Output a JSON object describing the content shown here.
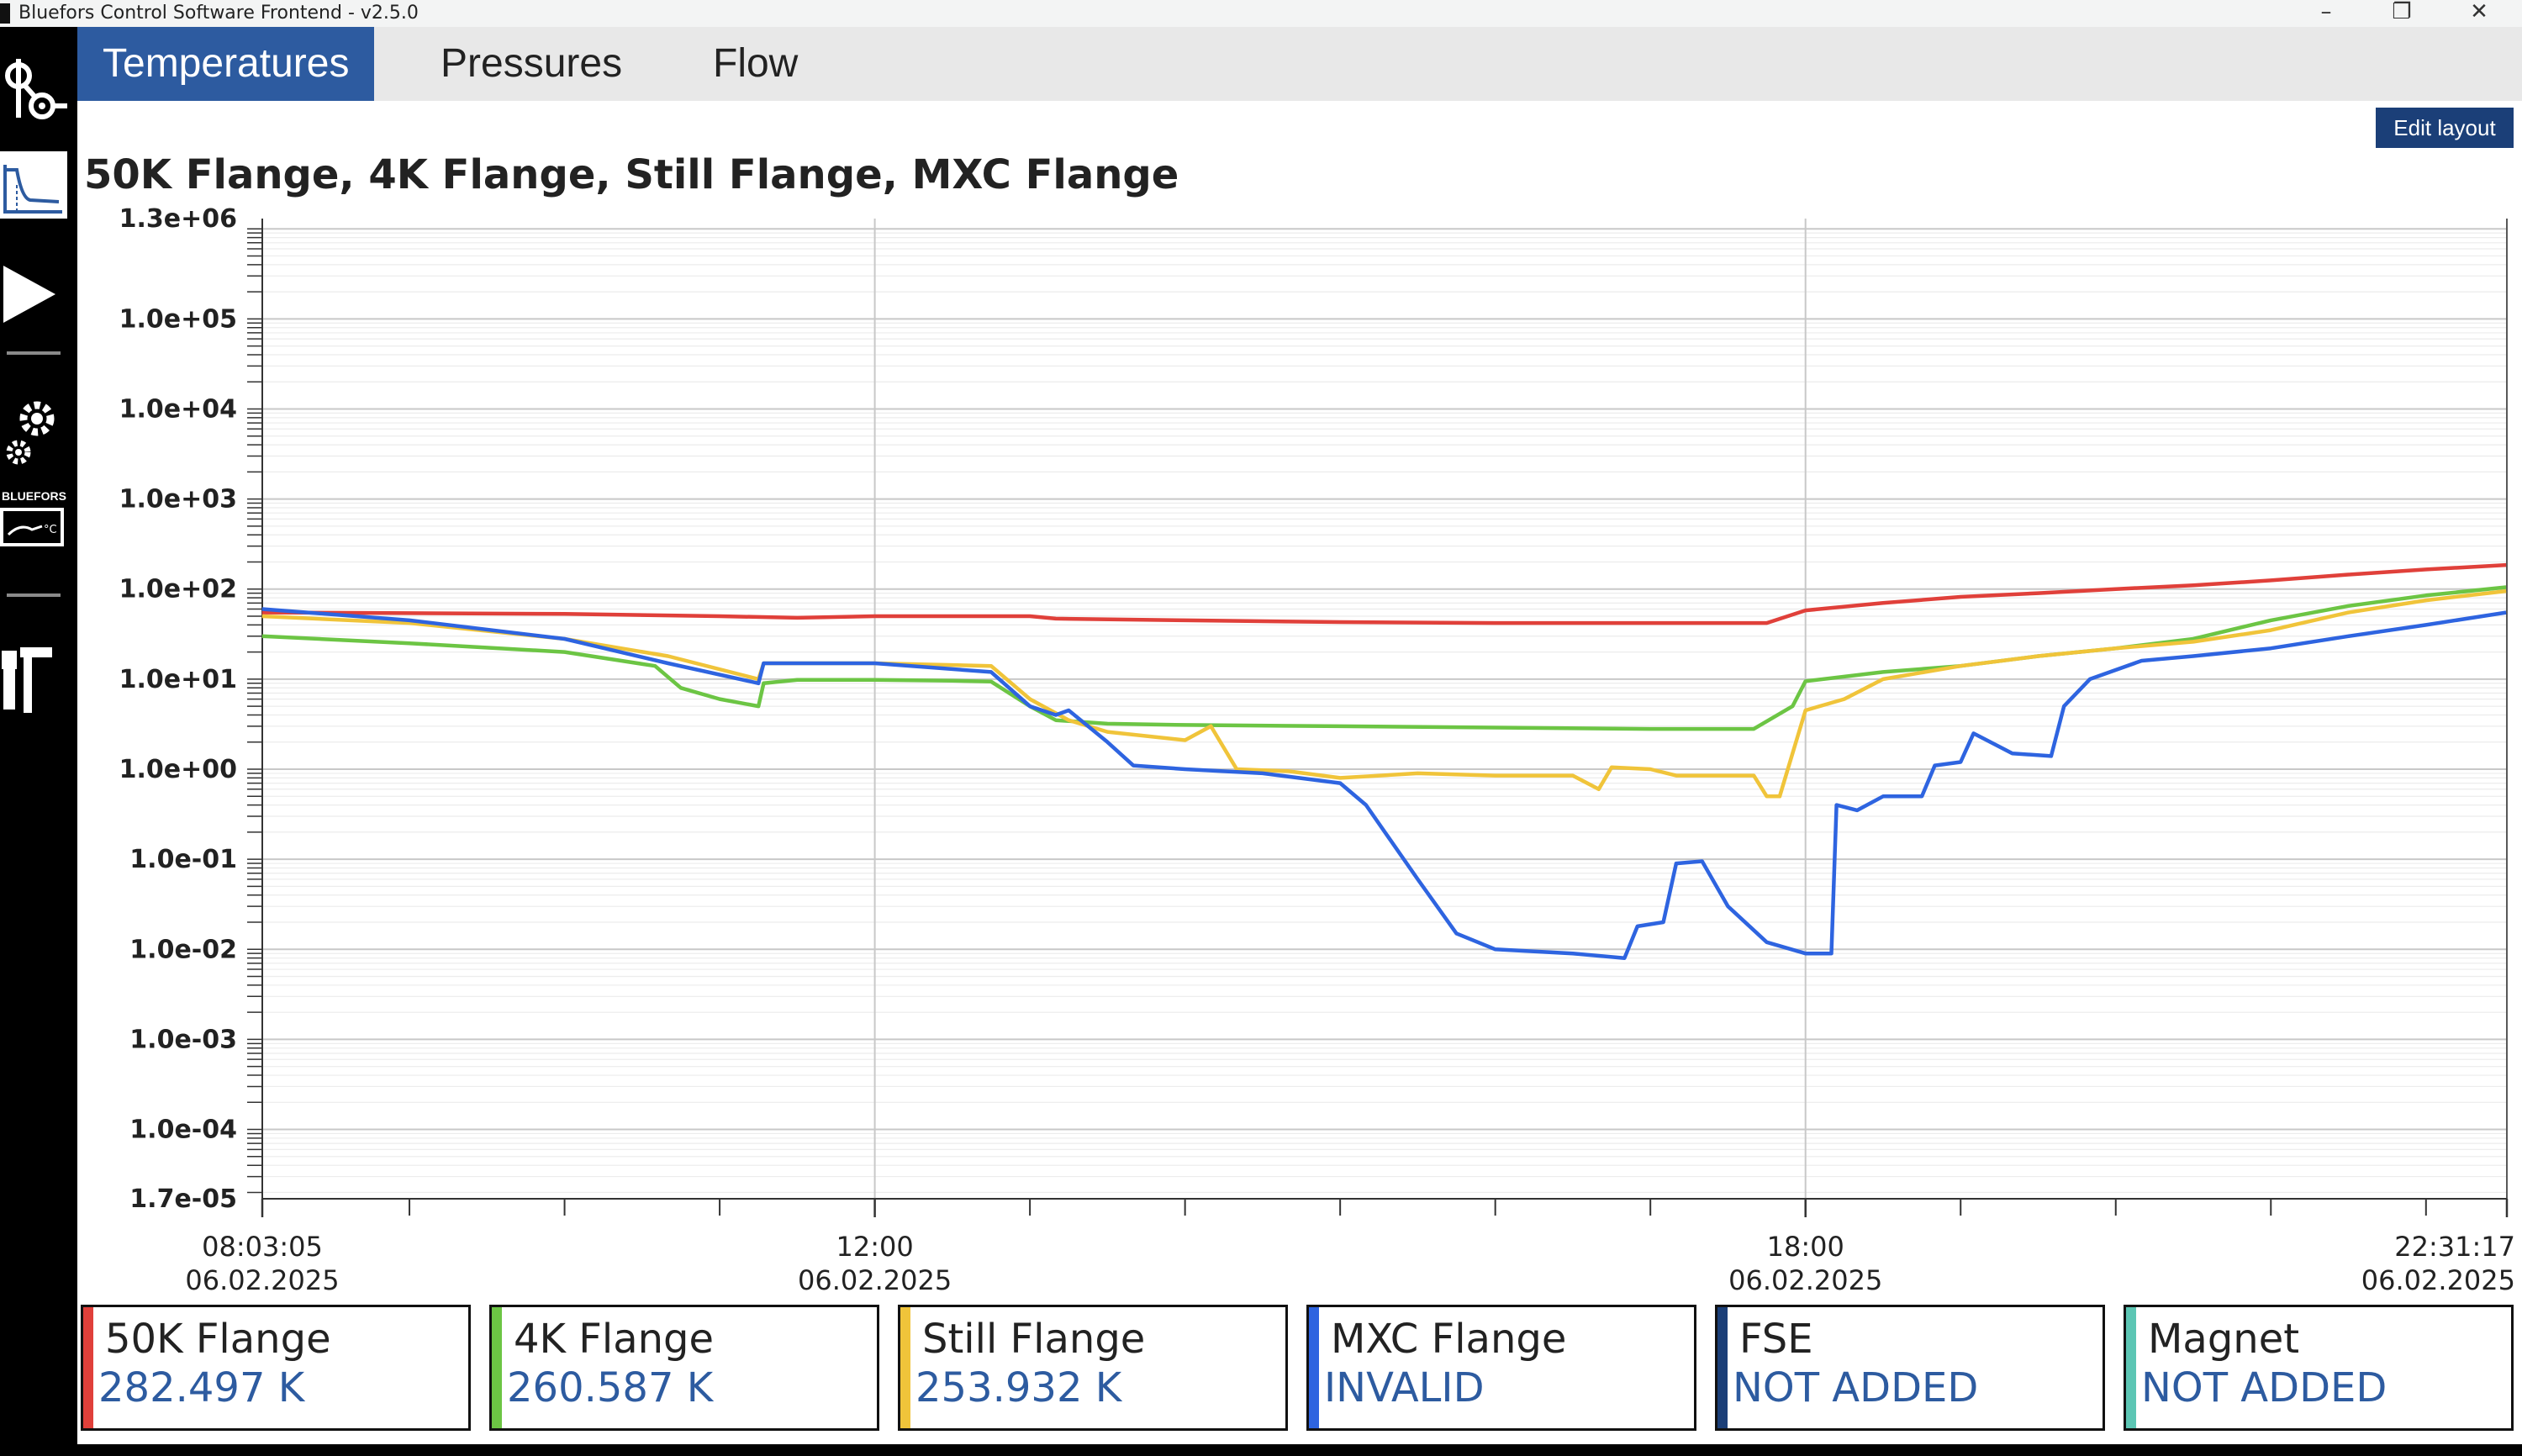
{
  "window": {
    "title": "Bluefors Control Software Frontend - v2.5.0",
    "controls": {
      "minimize": "–",
      "restore": "❐",
      "close": "✕"
    }
  },
  "sidebar": {
    "items": [
      {
        "icon": "gas-handling-icon"
      },
      {
        "icon": "play-icon"
      },
      {
        "icon": "gear-icon"
      },
      {
        "icon": "bluefors-temperature-icon",
        "label": "BLUEFORS"
      },
      {
        "icon": "tools-icon"
      }
    ]
  },
  "tabs": [
    {
      "label": "Temperatures",
      "active": true
    },
    {
      "label": "Pressures",
      "active": false
    },
    {
      "label": "Flow",
      "active": false
    }
  ],
  "toolbar": {
    "edit_layout_label": "Edit layout"
  },
  "chart": {
    "title": "50K Flange, 4K Flange, Still Flange, MXC Flange"
  },
  "chart_data": {
    "type": "line",
    "title": "50K Flange, 4K Flange, Still Flange, MXC Flange",
    "xlabel": "",
    "ylabel": "",
    "yscale": "log",
    "xlim": [
      "2025-02-06 08:03:05",
      "2025-02-06 22:31:17"
    ],
    "ylim": [
      1.7e-05,
      1300000.0
    ],
    "y_ticks": [
      {
        "value": 1300000.0,
        "label": "1.3e+06"
      },
      {
        "value": 100000.0,
        "label": "1.0e+05"
      },
      {
        "value": 10000.0,
        "label": "1.0e+04"
      },
      {
        "value": 1000.0,
        "label": "1.0e+03"
      },
      {
        "value": 100.0,
        "label": "1.0e+02"
      },
      {
        "value": 10.0,
        "label": "1.0e+01"
      },
      {
        "value": 1.0,
        "label": "1.0e+00"
      },
      {
        "value": 0.1,
        "label": "1.0e-01"
      },
      {
        "value": 0.01,
        "label": "1.0e-02"
      },
      {
        "value": 0.001,
        "label": "1.0e-03"
      },
      {
        "value": 0.0001,
        "label": "1.0e-04"
      },
      {
        "value": 1.7e-05,
        "label": "1.7e-05"
      }
    ],
    "x_ticks": [
      {
        "time": "2025-02-06 08:03:05",
        "label": "08:03:05",
        "date": "06.02.2025"
      },
      {
        "time": "2025-02-06 12:00:00",
        "label": "12:00",
        "date": "06.02.2025"
      },
      {
        "time": "2025-02-06 18:00:00",
        "label": "18:00",
        "date": "06.02.2025"
      },
      {
        "time": "2025-02-06 22:31:17",
        "label": "22:31:17",
        "date": "06.02.2025"
      }
    ],
    "x_minor_ticks": [
      "09:00",
      "10:00",
      "11:00",
      "13:00",
      "14:00",
      "15:00",
      "16:00",
      "17:00",
      "19:00",
      "20:00",
      "21:00",
      "22:00"
    ],
    "grid": true,
    "series": [
      {
        "name": "50K Flange",
        "color": "#e0403a",
        "points": [
          [
            "08:03",
            55
          ],
          [
            "09:00",
            54
          ],
          [
            "10:00",
            53
          ],
          [
            "11:00",
            50
          ],
          [
            "11:30",
            48
          ],
          [
            "12:00",
            50
          ],
          [
            "13:00",
            50
          ],
          [
            "13:10",
            47
          ],
          [
            "14:00",
            45
          ],
          [
            "15:00",
            43
          ],
          [
            "16:00",
            42
          ],
          [
            "17:00",
            42
          ],
          [
            "17:45",
            42
          ],
          [
            "18:00",
            58
          ],
          [
            "18:30",
            70
          ],
          [
            "19:00",
            82
          ],
          [
            "19:30",
            90
          ],
          [
            "20:00",
            100
          ],
          [
            "20:30",
            110
          ],
          [
            "21:00",
            125
          ],
          [
            "21:30",
            145
          ],
          [
            "22:00",
            165
          ],
          [
            "22:31",
            185
          ]
        ]
      },
      {
        "name": "4K Flange",
        "color": "#6cc544",
        "points": [
          [
            "08:03",
            30
          ],
          [
            "09:00",
            25
          ],
          [
            "10:00",
            20
          ],
          [
            "10:35",
            14
          ],
          [
            "10:45",
            8
          ],
          [
            "11:00",
            6
          ],
          [
            "11:15",
            5
          ],
          [
            "11:17",
            9
          ],
          [
            "11:30",
            9.8
          ],
          [
            "12:00",
            9.8
          ],
          [
            "12:30",
            9.6
          ],
          [
            "12:45",
            9.4
          ],
          [
            "13:00",
            5
          ],
          [
            "13:10",
            3.5
          ],
          [
            "13:30",
            3.2
          ],
          [
            "14:00",
            3.1
          ],
          [
            "15:00",
            3.0
          ],
          [
            "16:00",
            2.9
          ],
          [
            "17:00",
            2.8
          ],
          [
            "17:40",
            2.8
          ],
          [
            "17:55",
            5
          ],
          [
            "18:00",
            9.5
          ],
          [
            "18:30",
            12
          ],
          [
            "19:00",
            14
          ],
          [
            "19:30",
            18
          ],
          [
            "20:00",
            22
          ],
          [
            "20:30",
            28
          ],
          [
            "21:00",
            45
          ],
          [
            "21:30",
            65
          ],
          [
            "22:00",
            85
          ],
          [
            "22:31",
            105
          ]
        ]
      },
      {
        "name": "Still Flange",
        "color": "#f0c43a",
        "points": [
          [
            "08:03",
            50
          ],
          [
            "09:00",
            42
          ],
          [
            "10:00",
            28
          ],
          [
            "10:40",
            18
          ],
          [
            "11:15",
            10
          ],
          [
            "11:17",
            15
          ],
          [
            "12:00",
            15
          ],
          [
            "12:45",
            14
          ],
          [
            "13:00",
            6
          ],
          [
            "13:15",
            3.5
          ],
          [
            "13:30",
            2.6
          ],
          [
            "14:00",
            2.1
          ],
          [
            "14:10",
            3.0
          ],
          [
            "14:20",
            1.0
          ],
          [
            "14:40",
            0.95
          ],
          [
            "15:00",
            0.8
          ],
          [
            "15:30",
            0.9
          ],
          [
            "16:00",
            0.85
          ],
          [
            "16:30",
            0.85
          ],
          [
            "16:40",
            0.6
          ],
          [
            "16:45",
            1.05
          ],
          [
            "17:00",
            1.0
          ],
          [
            "17:10",
            0.85
          ],
          [
            "17:40",
            0.85
          ],
          [
            "17:45",
            0.5
          ],
          [
            "17:50",
            0.5
          ],
          [
            "17:55",
            1.5
          ],
          [
            "18:00",
            4.5
          ],
          [
            "18:15",
            6
          ],
          [
            "18:30",
            10
          ],
          [
            "19:00",
            14
          ],
          [
            "19:30",
            18
          ],
          [
            "20:00",
            22
          ],
          [
            "20:30",
            26
          ],
          [
            "21:00",
            35
          ],
          [
            "21:30",
            55
          ],
          [
            "22:00",
            75
          ],
          [
            "22:31",
            95
          ]
        ]
      },
      {
        "name": "MXC Flange",
        "color": "#2e64e0",
        "points": [
          [
            "08:03",
            60
          ],
          [
            "09:00",
            45
          ],
          [
            "10:00",
            28
          ],
          [
            "10:40",
            15
          ],
          [
            "11:15",
            9
          ],
          [
            "11:17",
            15
          ],
          [
            "12:00",
            15
          ],
          [
            "12:45",
            12
          ],
          [
            "13:00",
            5
          ],
          [
            "13:10",
            4
          ],
          [
            "13:15",
            4.5
          ],
          [
            "13:30",
            2
          ],
          [
            "13:40",
            1.1
          ],
          [
            "14:00",
            1.0
          ],
          [
            "14:30",
            0.9
          ],
          [
            "15:00",
            0.7
          ],
          [
            "15:10",
            0.4
          ],
          [
            "15:30",
            0.06
          ],
          [
            "15:45",
            0.015
          ],
          [
            "16:00",
            0.01
          ],
          [
            "16:30",
            0.009
          ],
          [
            "16:50",
            0.008
          ],
          [
            "16:55",
            0.018
          ],
          [
            "17:05",
            0.02
          ],
          [
            "17:10",
            0.09
          ],
          [
            "17:20",
            0.095
          ],
          [
            "17:30",
            0.03
          ],
          [
            "17:45",
            0.012
          ],
          [
            "18:00",
            0.009
          ],
          [
            "18:10",
            0.009
          ],
          [
            "18:12",
            0.4
          ],
          [
            "18:20",
            0.35
          ],
          [
            "18:30",
            0.5
          ],
          [
            "18:45",
            0.5
          ],
          [
            "18:50",
            1.1
          ],
          [
            "19:00",
            1.2
          ],
          [
            "19:05",
            2.5
          ],
          [
            "19:20",
            1.5
          ],
          [
            "19:35",
            1.4
          ],
          [
            "19:40",
            5
          ],
          [
            "19:50",
            10
          ],
          [
            "20:10",
            16
          ],
          [
            "20:30",
            18
          ],
          [
            "21:00",
            22
          ],
          [
            "21:30",
            30
          ],
          [
            "22:00",
            40
          ],
          [
            "22:31",
            55
          ]
        ]
      }
    ]
  },
  "legend": [
    {
      "name": "50K Flange",
      "value": "282.497 K",
      "color": "#e0403a"
    },
    {
      "name": "4K Flange",
      "value": "260.587 K",
      "color": "#6cc544"
    },
    {
      "name": "Still Flange",
      "value": "253.932 K",
      "color": "#f0c43a"
    },
    {
      "name": "MXC Flange",
      "value": "INVALID",
      "color": "#2e64e0"
    },
    {
      "name": "FSE",
      "value": "NOT ADDED",
      "color": "#1b3f78"
    },
    {
      "name": "Magnet",
      "value": "NOT ADDED",
      "color": "#5cc6b4"
    }
  ]
}
